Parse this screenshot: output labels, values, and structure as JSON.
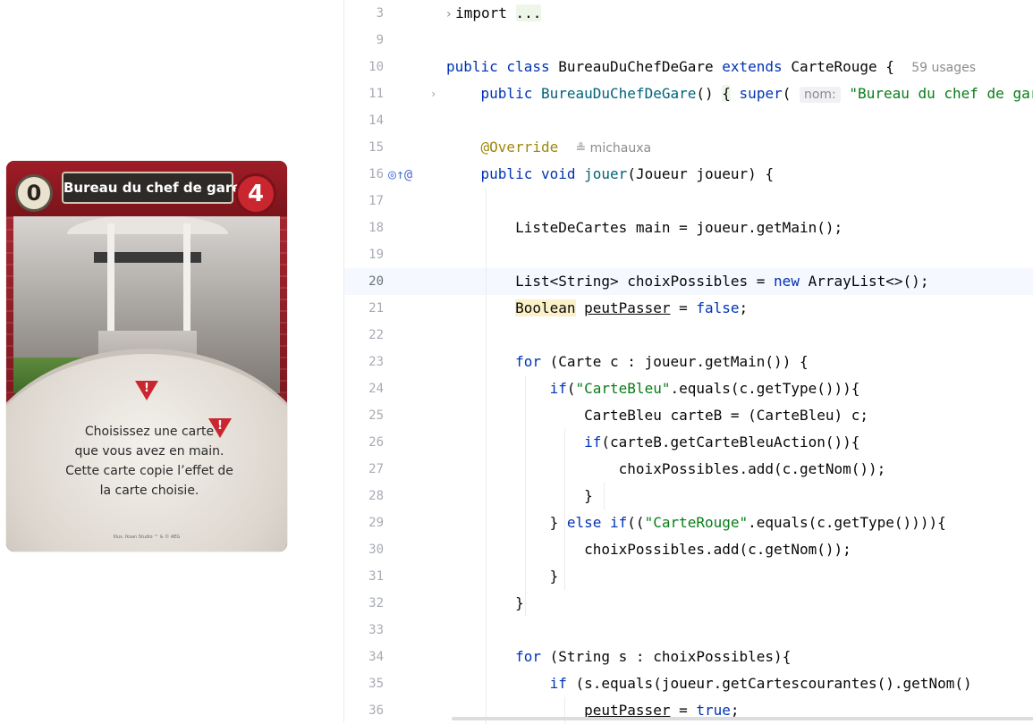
{
  "card": {
    "cost": "0",
    "title": "Bureau du chef de gare",
    "points": "4",
    "warning_glyph": "!",
    "text_lines": [
      "Choisissez une carte",
      "que vous avez en main.",
      "Cette carte copie l’effet de",
      "la carte choisie."
    ],
    "credit": "Illus. Iksan Studio ™ & © AEG",
    "colors": {
      "red": "#c9262f",
      "dark_red": "#8c1c24"
    }
  },
  "editor": {
    "lines": [
      {
        "n": "3",
        "html": "<span class='dim'>› </span>import <span class='fold-box'>...</span>"
      },
      {
        "n": "9",
        "html": ""
      },
      {
        "n": "10",
        "html": "<span class='kw'>public class</span> BureauDuChefDeGare <span class='kw'>extends</span> CarteRouge {  <span class='dim'>59 usages</span>"
      },
      {
        "n": "11",
        "html": "    <span class='kw'>public</span> <span class='fn'>BureauDuChefDeGare</span>() <span class='fold-box'>{</span> <span class='kw'>super</span>( <span class='hint'>nom:</span> <span class='str'>\"Bureau du chef de gare\"</span>"
      },
      {
        "n": "14",
        "html": ""
      },
      {
        "n": "15",
        "html": "    <span class='ann'>@Override</span>  <span class='dim'>≗ michauxa</span>"
      },
      {
        "n": "16",
        "html": "    <span class='kw'>public void</span> <span class='fn'>jouer</span>(Joueur joueur) {"
      },
      {
        "n": "17",
        "html": ""
      },
      {
        "n": "18",
        "html": "        ListeDeCartes main = joueur.getMain();"
      },
      {
        "n": "19",
        "html": ""
      },
      {
        "n": "20",
        "html": "        List&lt;String&gt; choixPossibles = <span class='kw'>new</span> ArrayList&lt;&gt;();"
      },
      {
        "n": "21",
        "html": "        <span class='warnbg'>Boolean</span> <span class='ul'>peutPasser</span> = <span class='kw'>false</span>;"
      },
      {
        "n": "22",
        "html": ""
      },
      {
        "n": "23",
        "html": "        <span class='kw'>for</span> (Carte c : joueur.getMain()) {"
      },
      {
        "n": "24",
        "html": "            <span class='kw'>if</span>(<span class='str'>\"CarteBleu\"</span>.equals(c.getType())){"
      },
      {
        "n": "25",
        "html": "                CarteBleu carteB = (CarteBleu) c;"
      },
      {
        "n": "26",
        "html": "                <span class='kw'>if</span>(carteB.getCarteBleuAction()){"
      },
      {
        "n": "27",
        "html": "                    choixPossibles.add(c.getNom());"
      },
      {
        "n": "28",
        "html": "                }"
      },
      {
        "n": "29",
        "html": "            } <span class='kw'>else if</span>((<span class='str'>\"CarteRouge\"</span>.equals(c.getType()))){"
      },
      {
        "n": "30",
        "html": "                choixPossibles.add(c.getNom());"
      },
      {
        "n": "31",
        "html": "            }"
      },
      {
        "n": "32",
        "html": "        }"
      },
      {
        "n": "33",
        "html": ""
      },
      {
        "n": "34",
        "html": "        <span class='kw'>for</span> (String s : choixPossibles){"
      },
      {
        "n": "35",
        "html": "            <span class='kw'>if</span> (s.equals(joueur.getCartescourantes().getNom()"
      },
      {
        "n": "36",
        "html": "                <span class='ul'>peutPasser</span> = <span class='kw'>true</span>;"
      }
    ],
    "current_line": "20",
    "gutter_icons": "◎↑@",
    "fold_lines": [
      "3",
      "11"
    ]
  }
}
